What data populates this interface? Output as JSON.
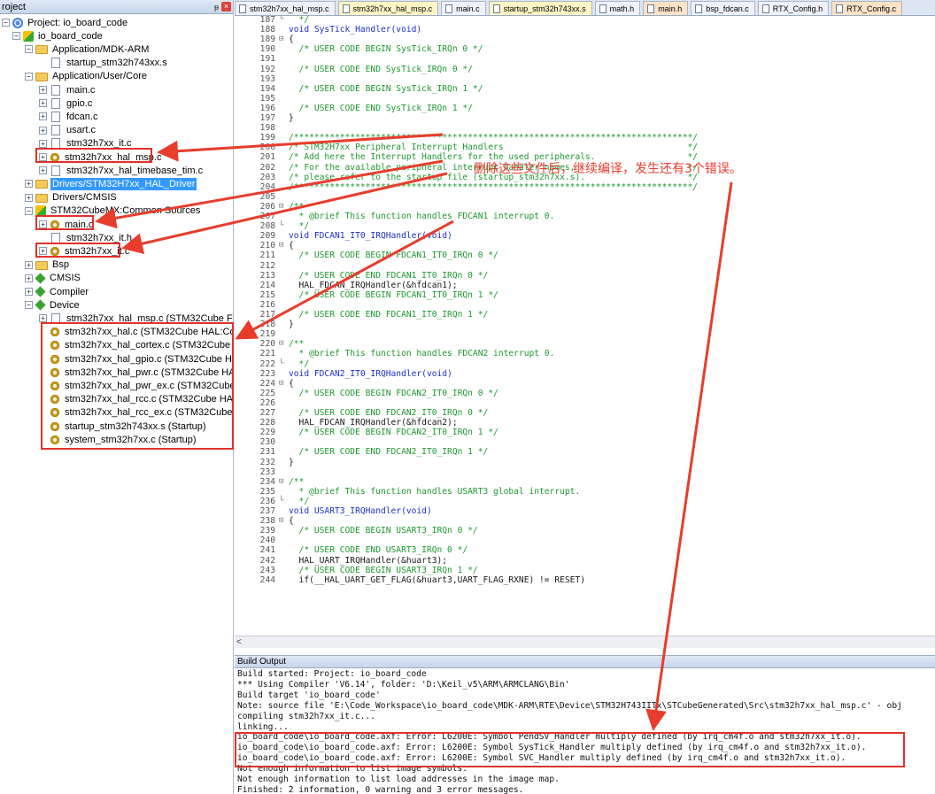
{
  "project_panel": {
    "title": "roject",
    "pin": "ᵽ",
    "close": "×",
    "items": [
      {
        "label": "Project: io_board_code",
        "expander": "−",
        "icon": "target-icon"
      },
      {
        "label": "io_board_code",
        "expander": "−",
        "icon": "lib-icon"
      },
      {
        "label": "Application/MDK-ARM",
        "expander": "−",
        "icon": "folder-icon"
      },
      {
        "label": "startup_stm32h743xx.s",
        "expander": "",
        "icon": "file-icon"
      },
      {
        "label": "Application/User/Core",
        "expander": "−",
        "icon": "folder-icon"
      },
      {
        "label": "main.c",
        "expander": "+",
        "icon": "file-icon"
      },
      {
        "label": "gpio.c",
        "expander": "+",
        "icon": "file-icon"
      },
      {
        "label": "fdcan.c",
        "expander": "+",
        "icon": "file-icon"
      },
      {
        "label": "usart.c",
        "expander": "+",
        "icon": "file-icon"
      },
      {
        "label": "stm32h7xx_it.c",
        "expander": "+",
        "icon": "file-icon"
      },
      {
        "label": "stm32h7xx_hal_msp.c",
        "expander": "+",
        "icon": "gear-icon"
      },
      {
        "label": "stm32h7xx_hal_timebase_tim.c",
        "expander": "+",
        "icon": "file-icon"
      },
      {
        "label": "Drivers/STM32H7xx_HAL_Driver",
        "expander": "+",
        "icon": "folder-icon"
      },
      {
        "label": "Drivers/CMSIS",
        "expander": "+",
        "icon": "folder-icon"
      },
      {
        "label": "STM32CubeMX:Common Sources",
        "expander": "−",
        "icon": "lib-icon"
      },
      {
        "label": "main.c",
        "expander": "+",
        "icon": "gear-icon"
      },
      {
        "label": "stm32h7xx_it.h",
        "expander": "",
        "icon": "file-icon"
      },
      {
        "label": "stm32h7xx_it.c",
        "expander": "+",
        "icon": "gear-icon"
      },
      {
        "label": "Bsp",
        "expander": "+",
        "icon": "folder-icon"
      },
      {
        "label": "CMSIS",
        "expander": "+",
        "icon": "gem-icon"
      },
      {
        "label": "Compiler",
        "expander": "+",
        "icon": "gem-icon"
      },
      {
        "label": "Device",
        "expander": "−",
        "icon": "gem-icon"
      },
      {
        "label": "stm32h7xx_hal_msp.c (STM32Cube Framework",
        "expander": "+",
        "icon": "file-icon"
      },
      {
        "label": "stm32h7xx_hal.c (STM32Cube HAL:Common)",
        "expander": "",
        "icon": "gear-icon"
      },
      {
        "label": "stm32h7xx_hal_cortex.c (STM32Cube HAL:Cort",
        "expander": "",
        "icon": "gear-icon"
      },
      {
        "label": "stm32h7xx_hal_gpio.c (STM32Cube HAL:GPIO)",
        "expander": "",
        "icon": "gear-icon"
      },
      {
        "label": "stm32h7xx_hal_pwr.c (STM32Cube HAL:PWR)",
        "expander": "",
        "icon": "gear-icon"
      },
      {
        "label": "stm32h7xx_hal_pwr_ex.c (STM32Cube HAL:PW",
        "expander": "",
        "icon": "gear-icon"
      },
      {
        "label": "stm32h7xx_hal_rcc.c (STM32Cube HAL:RCC)",
        "expander": "",
        "icon": "gear-icon"
      },
      {
        "label": "stm32h7xx_hal_rcc_ex.c (STM32Cube HAL:RCC",
        "expander": "",
        "icon": "gear-icon"
      },
      {
        "label": "startup_stm32h743xx.s (Startup)",
        "expander": "",
        "icon": "gear-icon"
      },
      {
        "label": "system_stm32h7xx.c (Startup)",
        "expander": "",
        "icon": "gear-icon"
      }
    ]
  },
  "tabs": [
    {
      "label": "stm32h7xx_hal_msp.c",
      "state": "normal",
      "icon": "gear-icon"
    },
    {
      "label": "stm32h7xx_hal_msp.c",
      "state": "active",
      "icon": "file-icon"
    },
    {
      "label": "main.c",
      "state": "normal",
      "icon": "file-icon"
    },
    {
      "label": "startup_stm32h743xx.s",
      "state": "active",
      "icon": "file-icon"
    },
    {
      "label": "math.h",
      "state": "normal",
      "icon": "file-icon"
    },
    {
      "label": "main.h",
      "state": "orange",
      "icon": "file-icon"
    },
    {
      "label": "bsp_fdcan.c",
      "state": "normal",
      "icon": "file-icon"
    },
    {
      "label": "RTX_Config.h",
      "state": "normal",
      "icon": "file-icon"
    },
    {
      "label": "RTX_Config.c",
      "state": "orange",
      "icon": "file-icon"
    }
  ],
  "code": [
    {
      "n": "187",
      "f": "└",
      "t": "  */",
      "c": "cm"
    },
    {
      "n": "188",
      "f": "",
      "t": "void SysTick_Handler(void)",
      "c": "kw"
    },
    {
      "n": "189",
      "f": "⊟",
      "t": "{",
      "c": ""
    },
    {
      "n": "190",
      "f": "",
      "t": "  /* USER CODE BEGIN SysTick_IRQn 0 */",
      "c": "cm"
    },
    {
      "n": "191",
      "f": "",
      "t": "",
      "c": ""
    },
    {
      "n": "192",
      "f": "",
      "t": "  /* USER CODE END SysTick_IRQn 0 */",
      "c": "cm"
    },
    {
      "n": "193",
      "f": "",
      "t": "",
      "c": ""
    },
    {
      "n": "194",
      "f": "",
      "t": "  /* USER CODE BEGIN SysTick_IRQn 1 */",
      "c": "cm"
    },
    {
      "n": "195",
      "f": "",
      "t": "",
      "c": ""
    },
    {
      "n": "196",
      "f": "",
      "t": "  /* USER CODE END SysTick_IRQn 1 */",
      "c": "cm"
    },
    {
      "n": "197",
      "f": "",
      "t": "}",
      "c": ""
    },
    {
      "n": "198",
      "f": "",
      "t": "",
      "c": ""
    },
    {
      "n": "199",
      "f": "",
      "t": "/******************************************************************************/",
      "c": "cm"
    },
    {
      "n": "200",
      "f": "",
      "t": "/* STM32H7xx Peripheral Interrupt Handlers                                    */",
      "c": "cm"
    },
    {
      "n": "201",
      "f": "",
      "t": "/* Add here the Interrupt Handlers for the used peripherals.                  */",
      "c": "cm"
    },
    {
      "n": "202",
      "f": "",
      "t": "/* For the available peripheral interrupt handler names,                      */",
      "c": "cm"
    },
    {
      "n": "203",
      "f": "",
      "t": "/* please refer to the startup file (startup_stm32h7xx.s).                    */",
      "c": "cm"
    },
    {
      "n": "204",
      "f": "",
      "t": "/******************************************************************************/",
      "c": "cm"
    },
    {
      "n": "205",
      "f": "",
      "t": "",
      "c": ""
    },
    {
      "n": "206",
      "f": "⊟",
      "t": "/**",
      "c": "cm"
    },
    {
      "n": "207",
      "f": "",
      "t": "  * @brief This function handles FDCAN1 interrupt 0.",
      "c": "cm"
    },
    {
      "n": "208",
      "f": "└",
      "t": "  */",
      "c": "cm"
    },
    {
      "n": "209",
      "f": "",
      "t": "void FDCAN1_IT0_IRQHandler(void)",
      "c": "kw"
    },
    {
      "n": "210",
      "f": "⊟",
      "t": "{",
      "c": ""
    },
    {
      "n": "211",
      "f": "",
      "t": "  /* USER CODE BEGIN FDCAN1_IT0_IRQn 0 */",
      "c": "cm"
    },
    {
      "n": "212",
      "f": "",
      "t": "",
      "c": ""
    },
    {
      "n": "213",
      "f": "",
      "t": "  /* USER CODE END FDCAN1_IT0_IRQn 0 */",
      "c": "cm"
    },
    {
      "n": "214",
      "f": "",
      "t": "  HAL_FDCAN_IRQHandler(&hfdcan1);",
      "c": ""
    },
    {
      "n": "215",
      "f": "",
      "t": "  /* USER CODE BEGIN FDCAN1_IT0_IRQn 1 */",
      "c": "cm"
    },
    {
      "n": "216",
      "f": "",
      "t": "",
      "c": ""
    },
    {
      "n": "217",
      "f": "",
      "t": "  /* USER CODE END FDCAN1_IT0_IRQn 1 */",
      "c": "cm"
    },
    {
      "n": "218",
      "f": "",
      "t": "}",
      "c": ""
    },
    {
      "n": "219",
      "f": "",
      "t": "",
      "c": ""
    },
    {
      "n": "220",
      "f": "⊟",
      "t": "/**",
      "c": "cm"
    },
    {
      "n": "221",
      "f": "",
      "t": "  * @brief This function handles FDCAN2 interrupt 0.",
      "c": "cm"
    },
    {
      "n": "222",
      "f": "└",
      "t": "  */",
      "c": "cm"
    },
    {
      "n": "223",
      "f": "",
      "t": "void FDCAN2_IT0_IRQHandler(void)",
      "c": "kw"
    },
    {
      "n": "224",
      "f": "⊟",
      "t": "{",
      "c": ""
    },
    {
      "n": "225",
      "f": "",
      "t": "  /* USER CODE BEGIN FDCAN2_IT0_IRQn 0 */",
      "c": "cm"
    },
    {
      "n": "226",
      "f": "",
      "t": "",
      "c": ""
    },
    {
      "n": "227",
      "f": "",
      "t": "  /* USER CODE END FDCAN2_IT0_IRQn 0 */",
      "c": "cm"
    },
    {
      "n": "228",
      "f": "",
      "t": "  HAL_FDCAN_IRQHandler(&hfdcan2);",
      "c": ""
    },
    {
      "n": "229",
      "f": "",
      "t": "  /* USER CODE BEGIN FDCAN2_IT0_IRQn 1 */",
      "c": "cm"
    },
    {
      "n": "230",
      "f": "",
      "t": "",
      "c": ""
    },
    {
      "n": "231",
      "f": "",
      "t": "  /* USER CODE END FDCAN2_IT0_IRQn 1 */",
      "c": "cm"
    },
    {
      "n": "232",
      "f": "",
      "t": "}",
      "c": ""
    },
    {
      "n": "233",
      "f": "",
      "t": "",
      "c": ""
    },
    {
      "n": "234",
      "f": "⊟",
      "t": "/**",
      "c": "cm"
    },
    {
      "n": "235",
      "f": "",
      "t": "  * @brief This function handles USART3 global interrupt.",
      "c": "cm"
    },
    {
      "n": "236",
      "f": "└",
      "t": "  */",
      "c": "cm"
    },
    {
      "n": "237",
      "f": "",
      "t": "void USART3_IRQHandler(void)",
      "c": "kw"
    },
    {
      "n": "238",
      "f": "⊟",
      "t": "{",
      "c": ""
    },
    {
      "n": "239",
      "f": "",
      "t": "  /* USER CODE BEGIN USART3_IRQn 0 */",
      "c": "cm"
    },
    {
      "n": "240",
      "f": "",
      "t": "",
      "c": ""
    },
    {
      "n": "241",
      "f": "",
      "t": "  /* USER CODE END USART3_IRQn 0 */",
      "c": "cm"
    },
    {
      "n": "242",
      "f": "",
      "t": "  HAL_UART_IRQHandler(&huart3);",
      "c": ""
    },
    {
      "n": "243",
      "f": "",
      "t": "  /* USER CODE BEGIN USART3_IRQn 1 */",
      "c": "cm"
    },
    {
      "n": "244",
      "f": "",
      "t": "  if(__HAL_UART_GET_FLAG(&huart3,UART_FLAG_RXNE) != RESET)",
      "c": ""
    }
  ],
  "scroll_left": "<",
  "build_output": {
    "title": "Build Output",
    "lines": [
      "Build started: Project: io_board_code",
      "*** Using Compiler 'V6.14', folder: 'D:\\Keil_v5\\ARM\\ARMCLANG\\Bin'",
      "Build target 'io_board_code'",
      "Note: source file 'E:\\Code_Workspace\\io_board_code\\MDK-ARM\\RTE\\Device\\STM32H743IITx\\STCubeGenerated\\Src\\stm32h7xx_hal_msp.c' - obj",
      "compiling stm32h7xx_it.c...",
      "linking...",
      "io_board_code\\io_board_code.axf: Error: L6200E: Symbol PendSV_Handler multiply defined (by irq_cm4f.o and stm32h7xx_it.o).",
      "io_board_code\\io_board_code.axf: Error: L6200E: Symbol SysTick_Handler multiply defined (by irq_cm4f.o and stm32h7xx_it.o).",
      "io_board_code\\io_board_code.axf: Error: L6200E: Symbol SVC_Handler multiply defined (by irq_cm4f.o and stm32h7xx_it.o).",
      "Not enough information to list image symbols.",
      "Not enough information to list load addresses in the image map.",
      "Finished: 2 information, 0 warning and 3 error messages."
    ]
  },
  "annotation": {
    "text": "删除这些文件后，继续编译，发生还有3个错误。",
    "color": "#e83c2c"
  },
  "colors": {
    "accent_red": "#e0322a",
    "selection_blue": "#3399ff",
    "comment_green": "#1d9a2f",
    "keyword_blue": "#1f30c8"
  }
}
